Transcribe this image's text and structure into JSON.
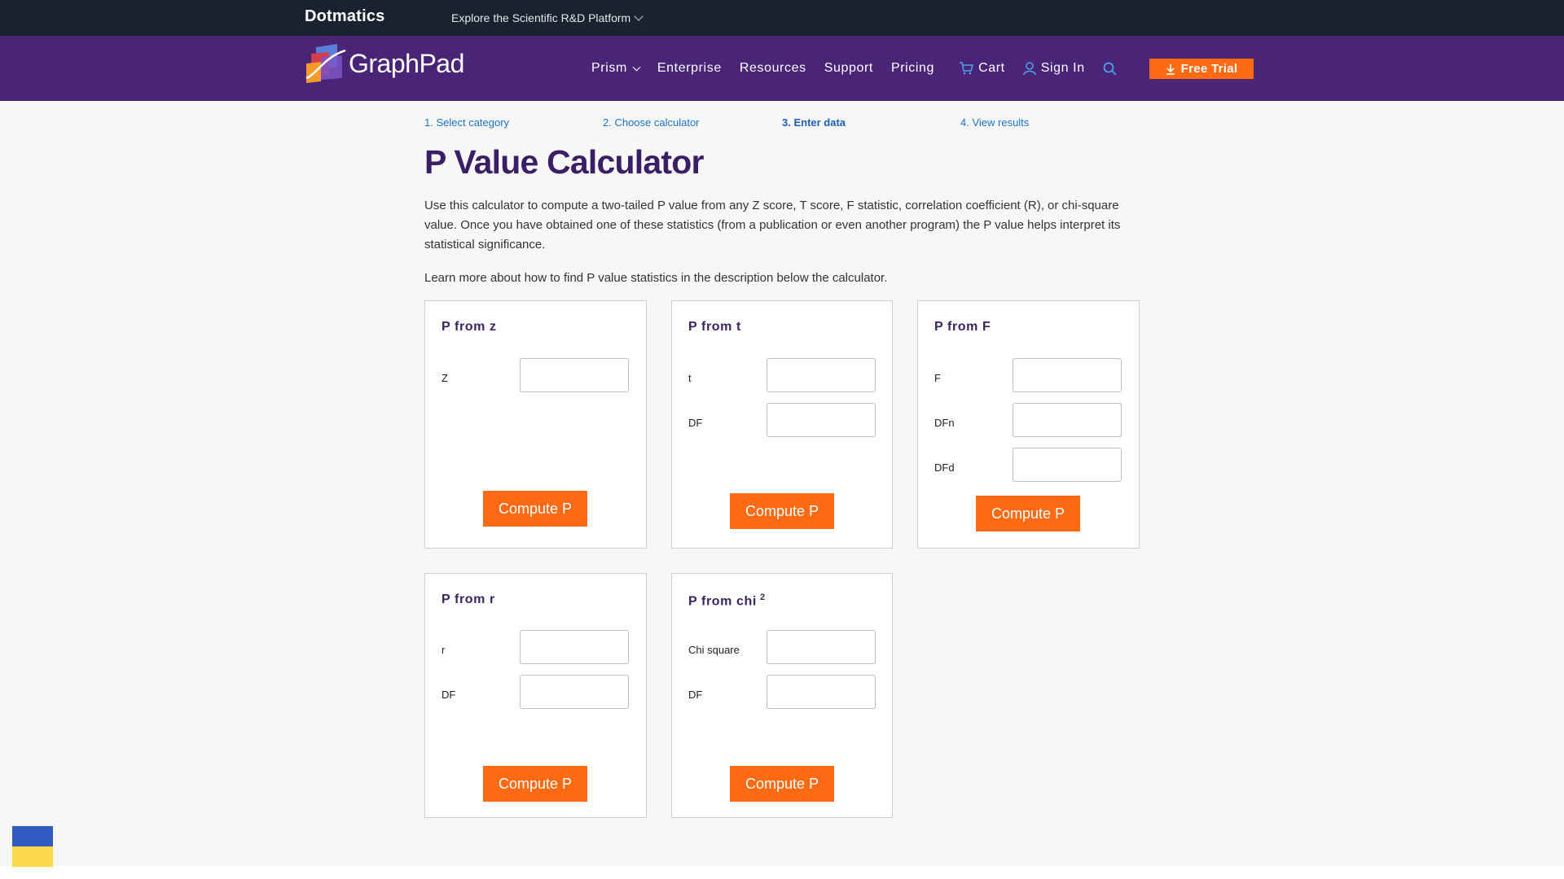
{
  "topbar": {
    "brand": "Dotmatics",
    "explore_label": "Explore the Scientific R&D Platform"
  },
  "nav": {
    "brand": "GraphPad",
    "items": [
      "Prism",
      "Enterprise",
      "Resources",
      "Support",
      "Pricing"
    ],
    "cart_label": "Cart",
    "signin_label": "Sign In",
    "free_trial_label": "Free Trial"
  },
  "steps": [
    "1. Select category",
    "2. Choose calculator",
    "3. Enter data",
    "4. View results"
  ],
  "page": {
    "title": "P Value Calculator",
    "intro": "Use this calculator to compute a two-tailed P value from any Z score, T score, F statistic, correlation coefficient (R), or chi-square value. Once you have obtained one of these statistics (from a publication or even another program) the P value helps interpret its statistical significance.",
    "learn_more": "Learn more about how to find P value statistics in the description below the calculator."
  },
  "cards": {
    "z": {
      "title": "P from z",
      "fields": [
        "Z"
      ],
      "button": "Compute P"
    },
    "t": {
      "title": "P from t",
      "fields": [
        "t",
        "DF"
      ],
      "button": "Compute P"
    },
    "f": {
      "title": "P from F",
      "fields": [
        "F",
        "DFn",
        "DFd"
      ],
      "button": "Compute P"
    },
    "r": {
      "title": "P from r",
      "fields": [
        "r",
        "DF"
      ],
      "button": "Compute P"
    },
    "chi": {
      "title": "P from chi",
      "title_sup": "2",
      "fields": [
        "Chi square",
        "DF"
      ],
      "button": "Compute P"
    }
  },
  "colors": {
    "nav_purple": "#4a2477",
    "topbar": "#18232f",
    "accent_orange": "#ff6a13",
    "title_purple": "#3b1f66"
  }
}
